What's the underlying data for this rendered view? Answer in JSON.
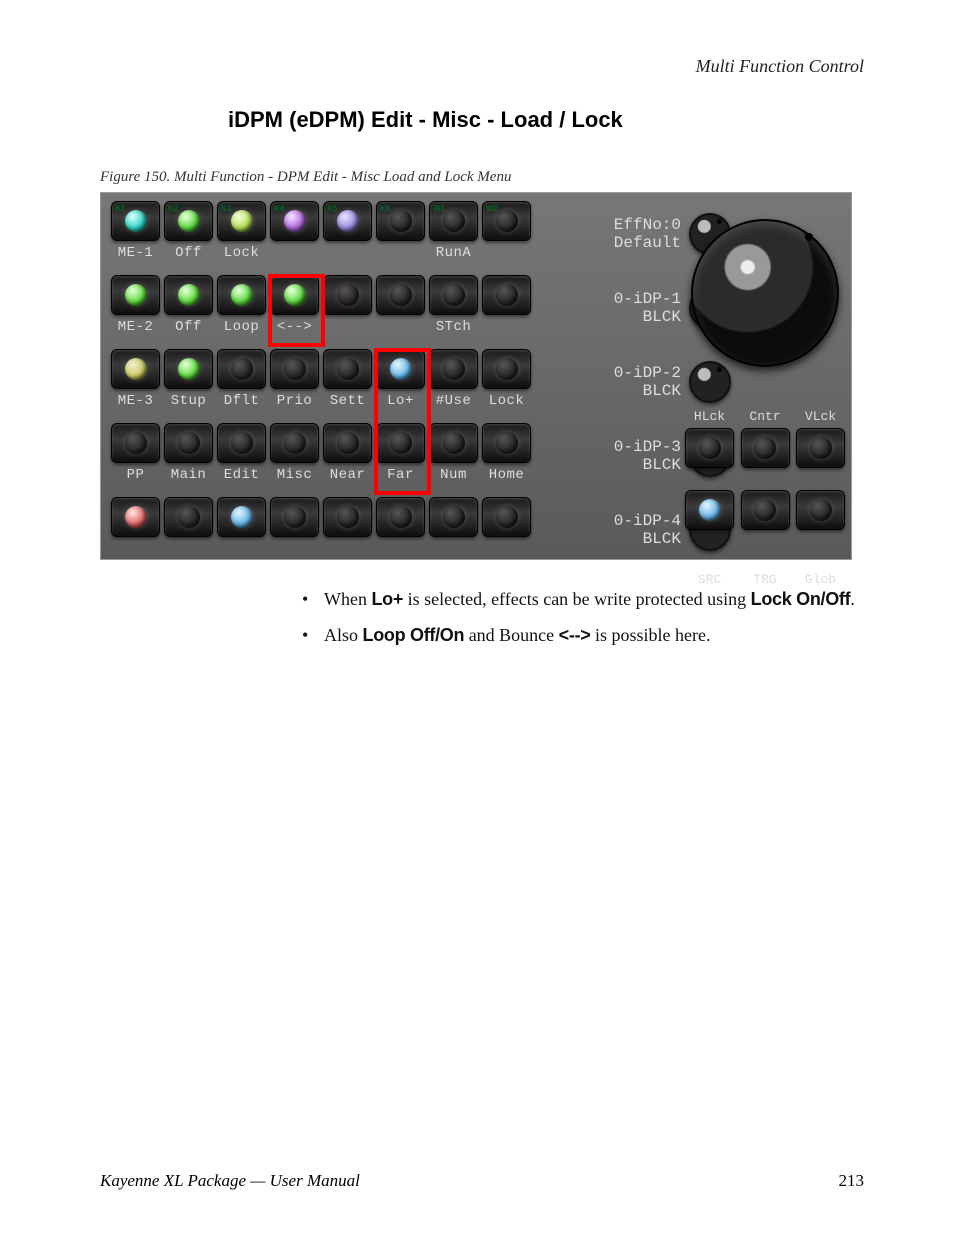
{
  "header": {
    "right": "Multi Function Control"
  },
  "section_title": "iDPM (eDPM) Edit - Misc - Load / Lock",
  "figure_caption": "Figure 150.  Multi Function - DPM Edit - Misc Load and Lock Menu",
  "panel": {
    "rows": [
      {
        "tags": [
          "K1",
          "K2",
          "K3",
          "K4",
          "K5",
          "K6",
          "W1",
          "W2"
        ],
        "leds": [
          "cyan",
          "green",
          "lime",
          "purple",
          "violet",
          "off",
          "off",
          "off"
        ],
        "labels": [
          "ME-1",
          "Off",
          "Lock",
          "",
          "",
          "",
          "RunA",
          ""
        ]
      },
      {
        "tags": [
          "",
          "",
          "",
          "",
          "",
          "",
          "",
          ""
        ],
        "leds": [
          "green",
          "green",
          "green",
          "green",
          "off",
          "off",
          "off",
          "off"
        ],
        "labels": [
          "ME-2",
          "Off",
          "Loop",
          "<-->",
          "",
          "",
          "STch",
          ""
        ]
      },
      {
        "tags": [
          "",
          "",
          "",
          "",
          "",
          "",
          "",
          ""
        ],
        "leds": [
          "olive",
          "green",
          "off",
          "off",
          "off",
          "skyblue",
          "off",
          "off"
        ],
        "labels": [
          "ME-3",
          "Stup",
          "Dflt",
          "Prio",
          "Sett",
          "Lo+",
          "#Use",
          "Lock"
        ]
      },
      {
        "tags": [
          "",
          "",
          "",
          "",
          "",
          "",
          "",
          ""
        ],
        "leds": [
          "off",
          "off",
          "off",
          "off",
          "off",
          "off",
          "off",
          "off"
        ],
        "labels": [
          "PP",
          "Main",
          "Edit",
          "Misc",
          "Near",
          "Far",
          "Num",
          "Home"
        ]
      },
      {
        "tags": [
          "",
          "",
          "",
          "",
          "",
          "",
          "",
          ""
        ],
        "leds": [
          "red",
          "off",
          "skyblue",
          "off",
          "off",
          "off",
          "off",
          "off"
        ],
        "labels": [
          "",
          "",
          "",
          "",
          "",
          "",
          "",
          ""
        ]
      }
    ],
    "mid": [
      {
        "line1": "EffNo:0",
        "line2": "Default"
      },
      {
        "line1": "0-iDP-1",
        "line2": "BLCK"
      },
      {
        "line1": "0-iDP-2",
        "line2": "BLCK"
      },
      {
        "line1": "0-iDP-3",
        "line2": "BLCK"
      },
      {
        "line1": "0-iDP-4",
        "line2": "BLCK"
      }
    ],
    "right": {
      "row1_labels": [
        "HLck",
        "Cntr",
        "VLck"
      ],
      "row1_leds": [
        "off",
        "off",
        "off"
      ],
      "row2_labels": [
        "SRC",
        "TRG",
        "Glob"
      ],
      "row2_leds": [
        "skyblue",
        "off",
        "off"
      ]
    }
  },
  "bullets": [
    {
      "pre": "When ",
      "b1": "Lo+",
      "mid": " is selected, effects can be write protected using ",
      "b2": "Lock On/Off",
      "post": "."
    },
    {
      "pre": "Also ",
      "b1": "Loop Off/On",
      "mid": " and Bounce ",
      "b2": "<-->",
      "post": " is possible here."
    }
  ],
  "footer": {
    "book": "Kayenne XL Package  —  User Manual",
    "page": "213"
  }
}
